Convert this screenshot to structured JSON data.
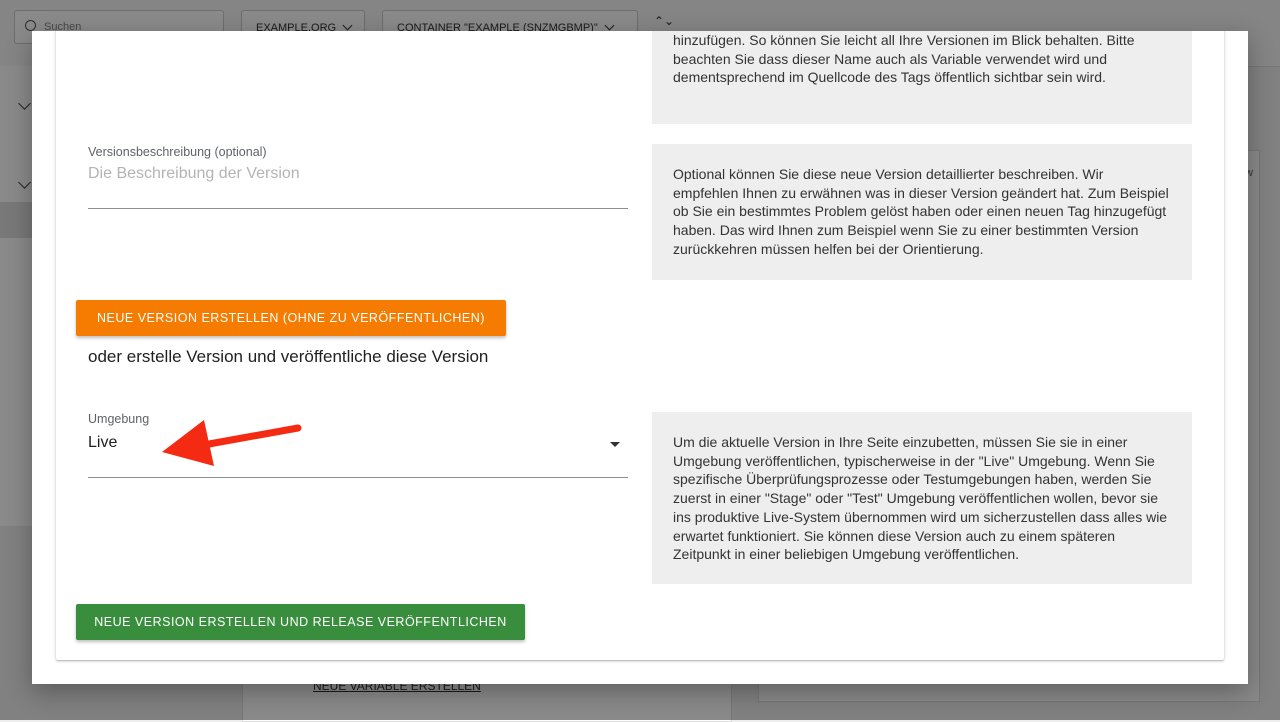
{
  "background": {
    "search_placeholder": "Suchen",
    "account_dropdown": "EXAMPLE.ORG",
    "container_dropdown": "CONTAINER \"EXAMPLE (SNZMGBMP)\"",
    "collapse_glyph": "⌃⌄",
    "right_panel_tag": "w",
    "center_link": "NEUE VARIABLE ERSTELLEN"
  },
  "dialog": {
    "help_name": "hinzufügen. So können Sie leicht all Ihre Versionen im Blick behalten. Bitte beachten Sie dass dieser Name auch als Variable verwendet wird und dementsprechend im Quellcode des Tags öffentlich sichtbar sein wird.",
    "description_field": {
      "label": "Versionsbeschreibung (optional)",
      "placeholder": "Die Beschreibung der Version",
      "value": ""
    },
    "help_description": "Optional können Sie diese neue Version detaillierter beschreiben. Wir empfehlen Ihnen zu erwähnen was in dieser Version geändert hat. Zum Beispiel ob Sie ein bestimmtes Problem gelöst haben oder einen neuen Tag hinzugefügt haben. Das wird Ihnen zum Beispiel wenn Sie zu einer bestimmten Version zurückkehren müssen helfen bei der Orientierung.",
    "create_without_publish_button": "NEUE VERSION ERSTELLEN (OHNE ZU VERÖFFENTLICHEN)",
    "or_publish_text": "oder erstelle Version und veröffentliche diese Version",
    "environment_field": {
      "label": "Umgebung",
      "selected": "Live"
    },
    "help_environment": "Um die aktuelle Version in Ihre Seite einzubetten, müssen Sie sie in einer Umgebung veröffentlichen, typischerweise in der \"Live\" Umgebung. Wenn Sie spezifische Überprüfungsprozesse oder Testumgebungen haben, werden Sie zuerst in einer \"Stage\" oder \"Test\" Umgebung veröffentlichen wollen, bevor sie ins produktive Live-System übernommen wird um sicherzustellen dass alles wie erwartet funktioniert. Sie können diese Version auch zu einem späteren Zeitpunkt in einer beliebigen Umgebung veröffentlichen.",
    "create_and_publish_button": "NEUE VERSION ERSTELLEN UND RELEASE VERÖFFENTLICHEN"
  },
  "colors": {
    "orange_button": "#f57c00",
    "green_button": "#388e3c",
    "annotation_arrow": "#f42a12",
    "help_box": "#eeeeee"
  }
}
